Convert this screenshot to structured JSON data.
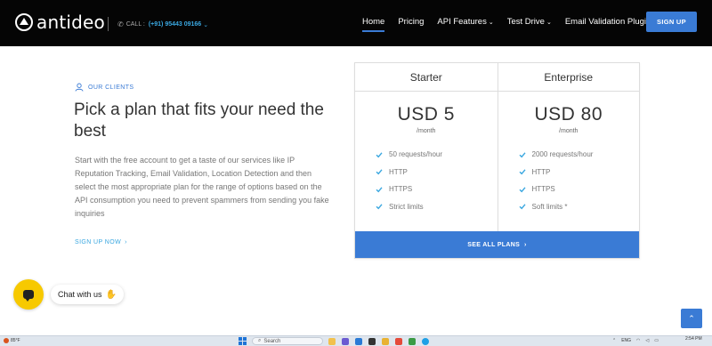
{
  "brand": {
    "name": "antideo"
  },
  "contact": {
    "call_label": "CALL :",
    "phone": "(+91) 95443 09166"
  },
  "nav": {
    "items": [
      {
        "label": "Home",
        "active": true,
        "has_caret": false
      },
      {
        "label": "Pricing",
        "active": false,
        "has_caret": false
      },
      {
        "label": "API Features",
        "active": false,
        "has_caret": true
      },
      {
        "label": "Test Drive",
        "active": false,
        "has_caret": true
      },
      {
        "label": "Email Validation Plugin",
        "active": false,
        "has_caret": false
      }
    ],
    "signup_label": "SIGN UP"
  },
  "hero": {
    "tag": "OUR CLIENTS",
    "title": "Pick a plan that fits your need the best",
    "description": "Start with the free account to get a taste of our services like IP Reputation Tracking, Email Validation, Location Detection and then select the most appropriate plan for the range of options based on the API consumption you need to prevent spammers from sending you fake inquiries",
    "cta": "SIGN UP NOW"
  },
  "pricing": {
    "plans": [
      {
        "name": "Starter",
        "price": "USD 5",
        "period": "/month",
        "features": [
          "50 requests/hour",
          "HTTP",
          "HTTPS",
          "Strict limits"
        ]
      },
      {
        "name": "Enterprise",
        "price": "USD 80",
        "period": "/month",
        "features": [
          "2000 requests/hour",
          "HTTP",
          "HTTPS",
          "Soft limits *"
        ]
      }
    ],
    "see_all": "SEE ALL PLANS"
  },
  "chat": {
    "label": "Chat with us"
  },
  "taskbar": {
    "weather": "85°F",
    "search_placeholder": "Search",
    "lang": "ENG",
    "time": "2:54 PM"
  },
  "colors": {
    "accent": "#3a7bd5",
    "link": "#3aa7e0",
    "chat": "#f7c900",
    "navbar": "#050505"
  }
}
